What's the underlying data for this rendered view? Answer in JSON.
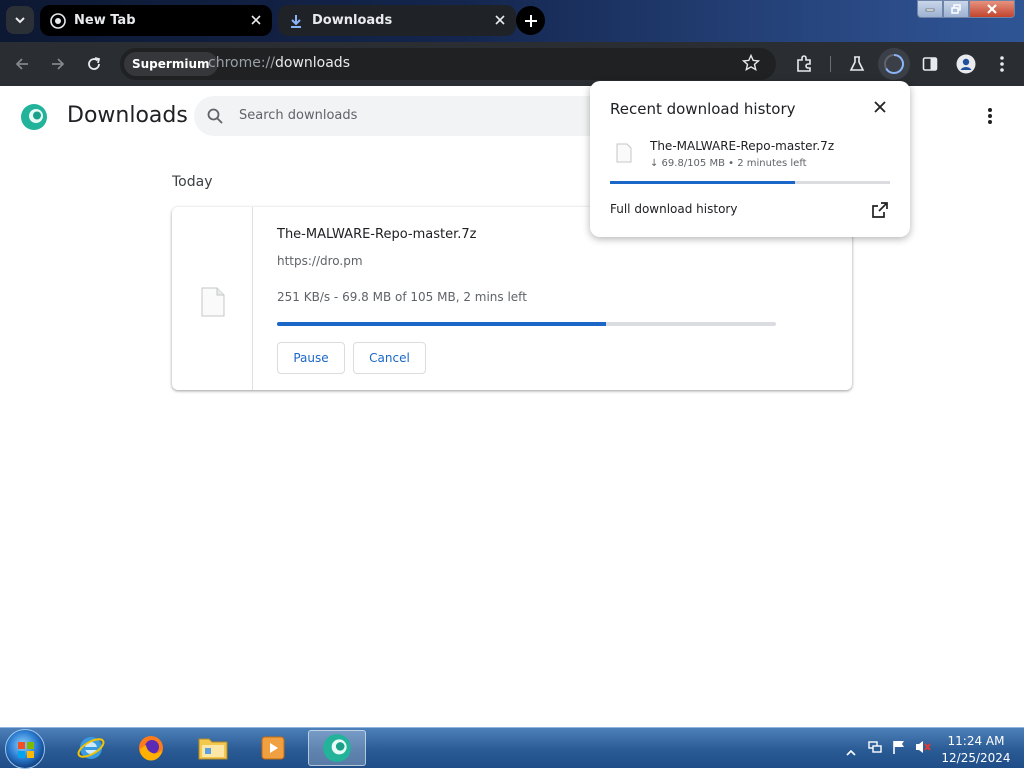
{
  "browser": {
    "tabs": [
      {
        "label": "New Tab"
      },
      {
        "label": "Downloads"
      }
    ],
    "site_chip": "Supermium",
    "url_scheme": "chrome://",
    "url_host": "downloads"
  },
  "page": {
    "title": "Downloads",
    "search_placeholder": "Search downloads",
    "section_label": "Today",
    "download": {
      "file_name": "The-MALWARE-Repo-master.7z",
      "source_url": "https://dro.pm",
      "status": "251 KB/s - 69.8 MB of 105 MB, 2 mins left",
      "progress_percent": 66,
      "pause_label": "Pause",
      "cancel_label": "Cancel"
    }
  },
  "popup": {
    "title": "Recent download history",
    "file_name": "The-MALWARE-Repo-master.7z",
    "status": "↓ 69.8/105 MB • 2 minutes left",
    "progress_percent": 66,
    "full_history_label": "Full download history"
  },
  "taskbar": {
    "apps": [
      "internet-explorer",
      "firefox",
      "file-explorer",
      "media-player",
      "supermium"
    ],
    "time": "11:24 AM",
    "date": "12/25/2024"
  },
  "colors": {
    "accent": "#1a67c8",
    "toolbar": "#2a2d31",
    "tabstrip": "#14264e"
  }
}
